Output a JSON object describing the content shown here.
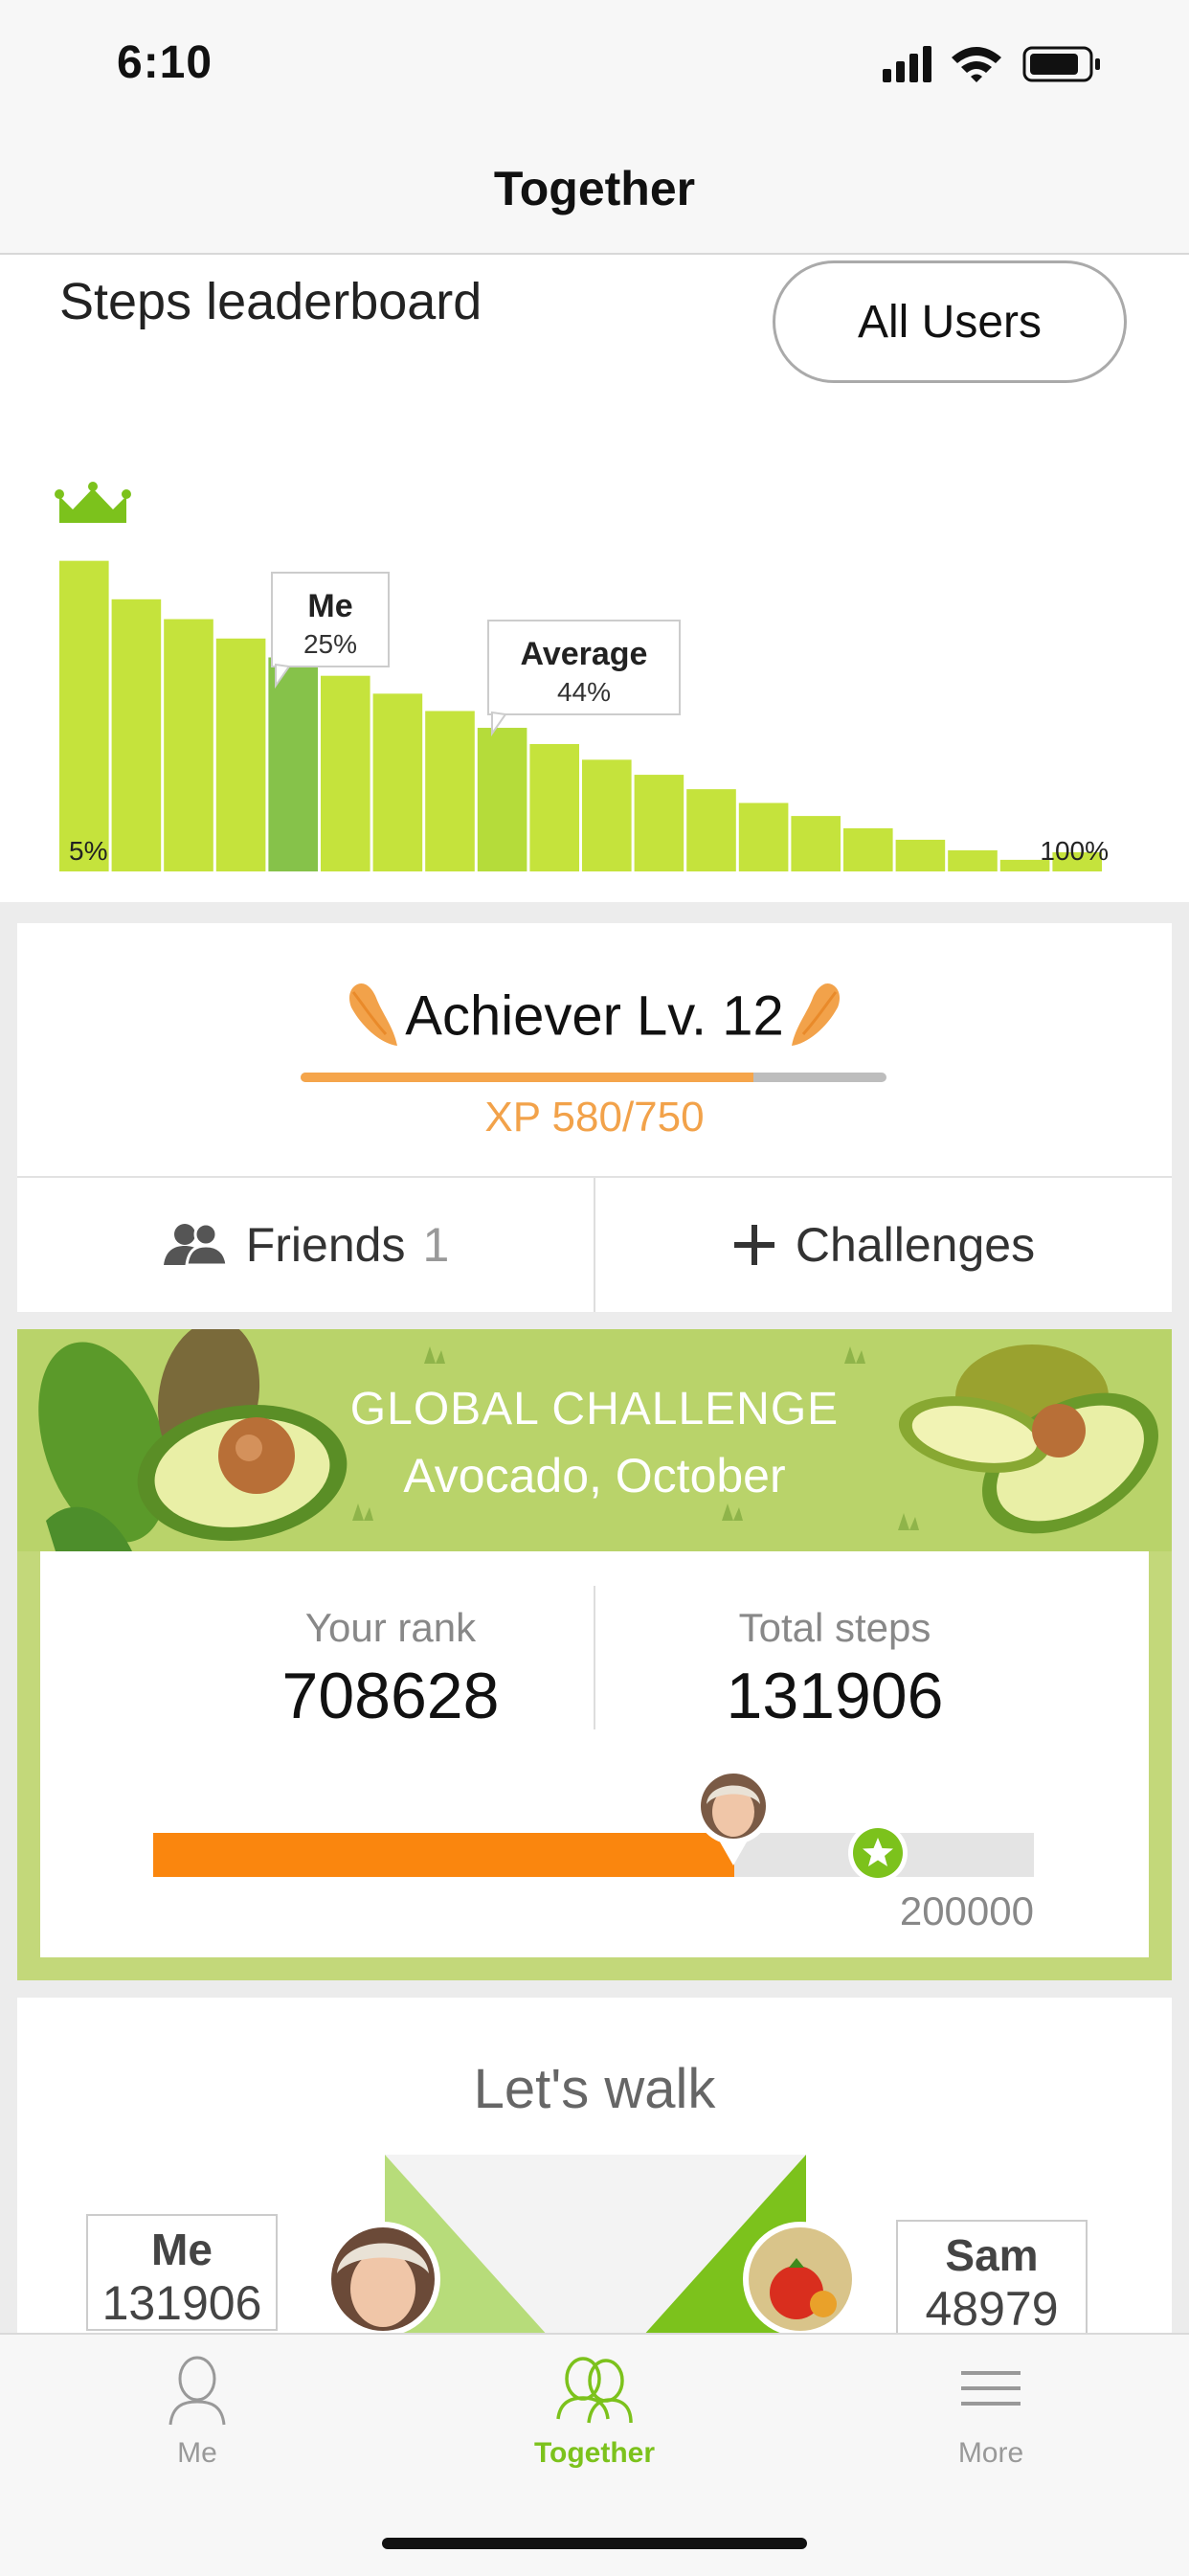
{
  "status_bar": {
    "time": "6:10"
  },
  "nav": {
    "title": "Together"
  },
  "leaderboard": {
    "title": "Steps leaderboard",
    "filter_button": "All Users",
    "me_label": "Me",
    "me_percent": "25%",
    "average_label": "Average",
    "average_percent": "44%",
    "left_axis": "5%",
    "right_axis": "100%"
  },
  "achiever": {
    "title": "Achiever Lv. 12",
    "xp_text": "XP 580/750",
    "xp_current": 580,
    "xp_max": 750
  },
  "actions": {
    "friends_label": "Friends",
    "friends_count": "1",
    "challenges_label": "Challenges"
  },
  "challenge": {
    "heading": "GLOBAL CHALLENGE",
    "subtitle": "Avocado, October",
    "rank_label": "Your rank",
    "rank_value": "708628",
    "steps_label": "Total steps",
    "steps_value": "131906",
    "goal": "200000",
    "progress_fraction": 0.66
  },
  "walk": {
    "title": "Let's walk",
    "me_name": "Me",
    "me_steps": "131906",
    "other_name": "Sam",
    "other_steps": "48979"
  },
  "tabbar": {
    "me": "Me",
    "together": "Together",
    "more": "More"
  },
  "colors": {
    "accent_green": "#7cc21c",
    "bar_green": "#c5e33c",
    "orange": "#fa860e",
    "xp_orange": "#f2a24a"
  }
}
